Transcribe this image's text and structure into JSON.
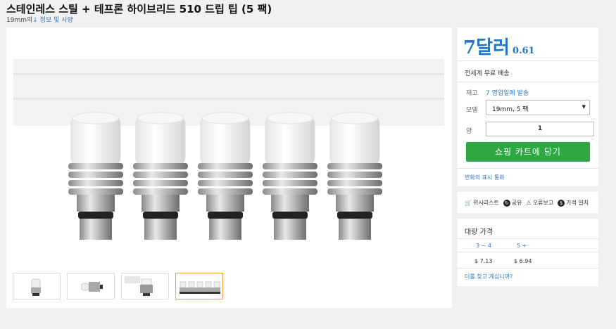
{
  "product": {
    "title": "스테인레스 스틸 + 테프론 하이브리드 510 드립 팁 (5 팩)",
    "subtitle_prefix": "19mm의",
    "info_link": "↓ 정보 및 사양"
  },
  "gallery": {
    "thumbnails": [
      "thumb-1",
      "thumb-2",
      "thumb-3",
      "thumb-4"
    ],
    "active_index": 3
  },
  "purchase": {
    "price_main": "7달러",
    "price_sub": "0.61",
    "shipping": "전세계 무료 배송",
    "stock_label": "재고",
    "stock_value": "7 영업일에 발송",
    "model_label": "모델",
    "model_value": "19mm, 5 팩",
    "qty_label": "양",
    "qty_value": "1",
    "cart_button": "쇼핑 카트에 담기",
    "currency_link": "변화의 표시 통화",
    "accent_color": "#1e77c8",
    "button_color": "#2ea842"
  },
  "actions": {
    "wishlist": "위시리스트",
    "share": "공유",
    "report": "오류보고",
    "price_alert": "가격 일치"
  },
  "bulk": {
    "title": "대량 가격",
    "tiers": [
      {
        "range": "3 ~ 4",
        "price": "$ 7.13"
      },
      {
        "range": "5 +",
        "price": "$ 6.94"
      }
    ],
    "question_link": "더를 찾고 계십니까?"
  }
}
